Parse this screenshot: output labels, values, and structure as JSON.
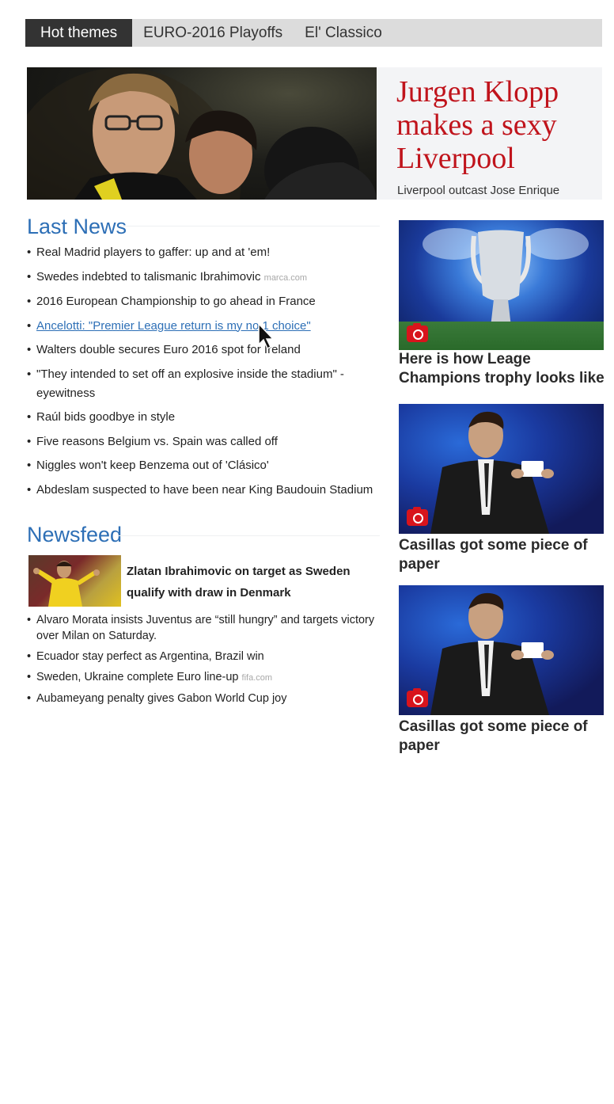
{
  "tabs": {
    "hot": "Hot themes",
    "euro": "EURO-2016 Playoffs",
    "classico": "El' Classico"
  },
  "hero": {
    "title": "Jurgen Klopp makes a sexy Liverpool",
    "subtitle": "Liverpool outcast Jose Enrique"
  },
  "last_news": {
    "heading": "Last News",
    "items": [
      {
        "text": "Real Madrid players to gaffer: up and at 'em!",
        "source": ""
      },
      {
        "text": "Swedes indebted to talismanic Ibrahimovic",
        "source": "marca.com"
      },
      {
        "text": "2016 European Championship to go ahead in France",
        "source": ""
      },
      {
        "text": "Ancelotti: \"Premier League return is my no 1 choice\"",
        "source": ""
      },
      {
        "text": "Walters double secures Euro 2016 spot for Ireland",
        "source": ""
      },
      {
        "text": "\"They intended to set off an explosive inside the stadium\" - eyewitness",
        "source": ""
      },
      {
        "text": "Raúl bids goodbye in style",
        "source": ""
      },
      {
        "text": "Five reasons Belgium vs. Spain was called off",
        "source": ""
      },
      {
        "text": "Niggles won't keep Benzema out of 'Clásico'",
        "source": ""
      },
      {
        "text": "Abdeslam suspected to have been near King Baudouin Stadium",
        "source": ""
      }
    ]
  },
  "newsfeed": {
    "heading": "Newsfeed",
    "top_story": "Zlatan Ibrahimovic on target as Sweden qualify with draw in Denmark",
    "items": [
      {
        "text": "Alvaro Morata insists Juventus are “still hungry” and targets victory over Milan on Saturday.",
        "source": ""
      },
      {
        "text": "Ecuador stay perfect as Argentina, Brazil win",
        "source": ""
      },
      {
        "text": "Sweden, Ukraine complete Euro line-up",
        "source": "fifa.com"
      },
      {
        "text": "Aubameyang penalty gives Gabon World Cup joy",
        "source": ""
      }
    ]
  },
  "cards": [
    {
      "title": "Here is how Leage Champions trophy looks like"
    },
    {
      "title": "Casillas got some piece of paper"
    },
    {
      "title": "Casillas got some piece of paper"
    }
  ],
  "colors": {
    "accent_red": "#c0141c",
    "link_blue": "#2d6fb6",
    "tab_active": "#333333",
    "tab_bar": "#dcdcdc"
  }
}
